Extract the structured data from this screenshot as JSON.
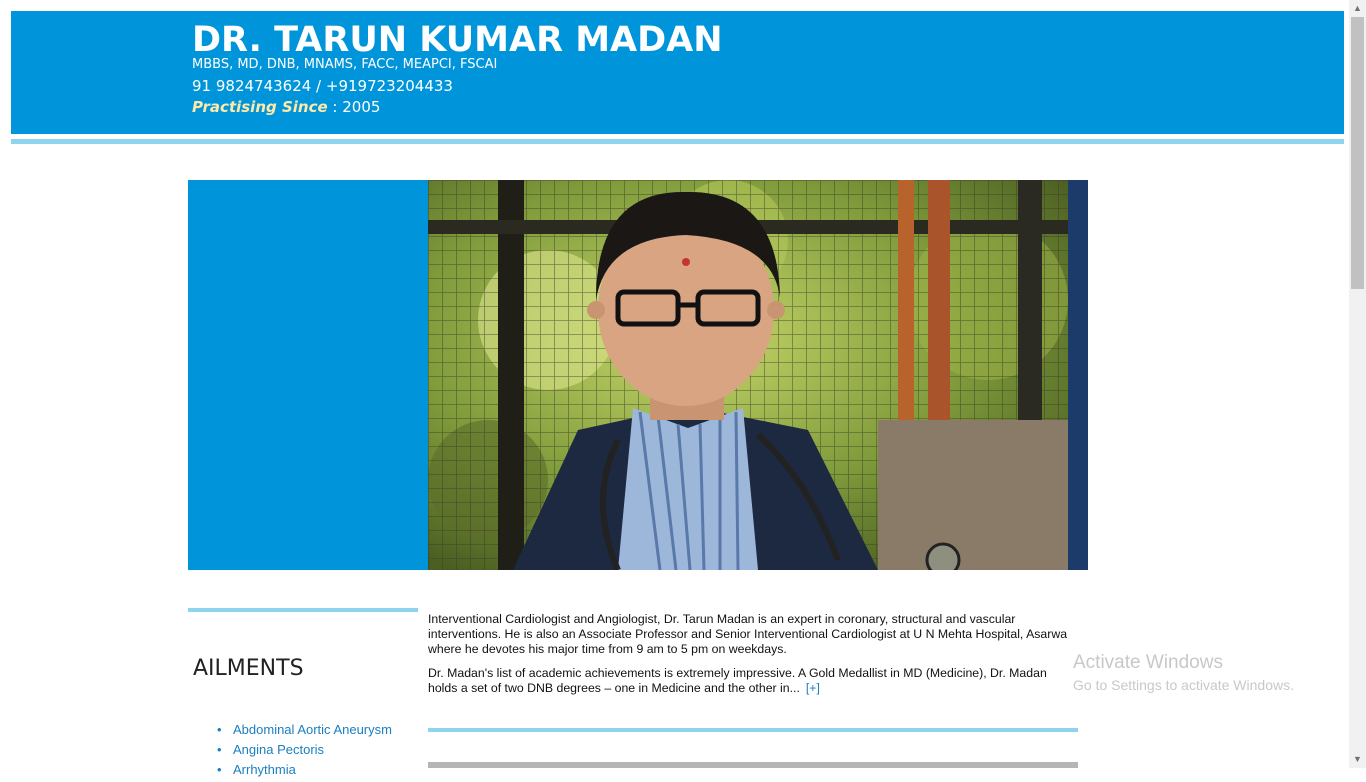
{
  "header": {
    "name": "DR. TARUN KUMAR MADAN",
    "degrees": "MBBS, MD, DNB, MNAMS, FACC, MEAPCI, FSCAI",
    "phones": "91 9824743624 / +919723204433",
    "since_label": "Practising Since",
    "since_sep": " : ",
    "since_value": "2005"
  },
  "sidebar": {
    "title": "AILMENTS",
    "items": [
      "Abdominal Aortic Aneurysm",
      "Angina Pectoris",
      "Arrhythmia"
    ]
  },
  "bio": {
    "para1": "Interventional Cardiologist and Angiologist, Dr. Tarun Madan is an expert in coronary, structural and vascular interventions. He is also an Associate Professor and Senior Interventional Cardiologist at U N Mehta Hospital, Asarwa where he devotes his major time from 9 am to 5 pm on weekdays.",
    "para2": "Dr. Madan's list of academic achievements is extremely impressive. A Gold Medallist in MD (Medicine), Dr. Madan holds a set of two DNB degrees – one in Medicine and the other in...",
    "more": "[+]"
  },
  "watermark": {
    "title": "Activate Windows",
    "subtitle": "Go to Settings to activate Windows."
  },
  "colors": {
    "brand_blue": "#0095db",
    "light_blue": "#8fd4ec",
    "link": "#1a7fc1"
  }
}
